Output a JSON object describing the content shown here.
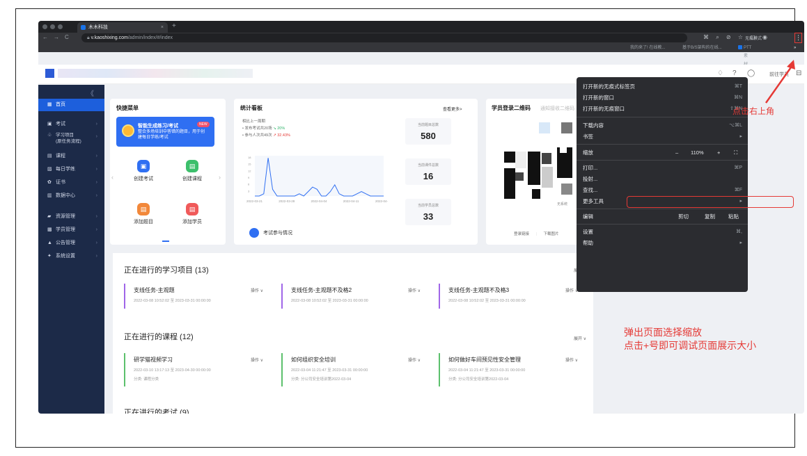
{
  "browser": {
    "tab_title": "木木科技",
    "tab_close": "×",
    "new_tab": "+",
    "nav": [
      "←",
      "→",
      "C"
    ],
    "url_domain": "v.kaoshixing.com",
    "url_path": "/admin/index/#/index",
    "toolbar_icons": "⌘ ⌕ ⊘ ☆ ▢ ◉",
    "incognito_label": "无痕模式",
    "kebab": "⋮",
    "bookmarks": [
      "我的来了! 在线教...",
      "基于B/S架构的在线...",
      "PTT素材网"
    ],
    "bookmark_more": "»"
  },
  "app_header": {
    "icons": [
      "♢",
      "?",
      "◯"
    ],
    "user_link": "前往学员",
    "exit_icon": "⊟"
  },
  "sidebar": {
    "collapse": "《",
    "items": [
      {
        "icon": "▦",
        "label": "首页",
        "active": true
      },
      {
        "icon": "▣",
        "label": "考试"
      },
      {
        "icon": "♧",
        "label": "学习项目\n(原任务流程)"
      },
      {
        "icon": "▤",
        "label": "课程"
      },
      {
        "icon": "▨",
        "label": "每日学练"
      },
      {
        "icon": "✿",
        "label": "证书"
      },
      {
        "icon": "▥",
        "label": "数据中心"
      },
      {
        "icon": "▰",
        "label": "资源管理"
      },
      {
        "icon": "▩",
        "label": "学员管理"
      },
      {
        "icon": "▲",
        "label": "公告管理"
      },
      {
        "icon": "✦",
        "label": "系统设置"
      }
    ],
    "chevron": "›"
  },
  "quick_menu": {
    "title": "快捷菜单",
    "hero_title": "智能生成练习/考试",
    "hero_tag": "NEW",
    "hero_desc": "整合多场培训中答错的题目，用于创建每日学练/考试",
    "actions": [
      {
        "label": "创建考试",
        "color": "#2f6ff2",
        "icon": "▣"
      },
      {
        "label": "创建课程",
        "color": "#3cbf6b",
        "icon": "▤"
      },
      {
        "label": "添加题目",
        "color": "#f2883a",
        "icon": "▤"
      },
      {
        "label": "添加学员",
        "color": "#f05a5a",
        "icon": "▤"
      }
    ],
    "arrows": [
      "‹",
      "›"
    ]
  },
  "stats": {
    "title": "统计看板",
    "more": "查看更多>",
    "compare_label": "相比上一周期",
    "line1": "• 发布考试共20场",
    "line1_delta": "↘ 20%",
    "line2": "• 参与人次共49次",
    "line2_delta": "↗ 32.43%",
    "kpis": [
      {
        "label": "当前题目总数",
        "value": "580"
      },
      {
        "label": "当前课件总数",
        "value": "16"
      },
      {
        "label": "当前学员总数",
        "value": "33"
      }
    ],
    "exam_link": "考试参与情况"
  },
  "chart_data": {
    "type": "line",
    "x": [
      "2022-03-21",
      "2022-03-28",
      "2022-04-04",
      "2022-04-11",
      "2022-04-"
    ],
    "x_ticks": [
      "2022-03-21",
      "2022-03-28",
      "2022-04-04",
      "2022-04-11",
      "2022-04-"
    ],
    "y_ticks": [
      "18",
      "15",
      "12",
      "9",
      "6",
      "3"
    ],
    "ylim": [
      0,
      18
    ],
    "series": [
      {
        "values": [
          0,
          0,
          1,
          17,
          3,
          0,
          0,
          0,
          0,
          0,
          1,
          0,
          2,
          4,
          3,
          0,
          0,
          2,
          5,
          1,
          0,
          0,
          0,
          1,
          2,
          1,
          0,
          0,
          0,
          0
        ]
      }
    ],
    "color": "#2f6ff2"
  },
  "qr": {
    "title": "学员登录二维码",
    "subtitle": "通知接收二维码",
    "watermark": "无系统",
    "link": "登录链接",
    "download": "下载图片"
  },
  "context_menu": {
    "items": [
      {
        "label": "打开新的无痕式标签页",
        "shortcut": "⌘T"
      },
      {
        "label": "打开新的窗口",
        "shortcut": "⌘N"
      },
      {
        "label": "打开新的无痕窗口",
        "shortcut": "⇧⌘N"
      },
      {
        "label": "下载内容",
        "shortcut": "⌥⌘L"
      },
      {
        "label": "书签",
        "shortcut": "▸"
      },
      {
        "label": "缩放",
        "shortcut": ""
      },
      {
        "label": "打印...",
        "shortcut": "⌘P"
      },
      {
        "label": "投射...",
        "shortcut": ""
      },
      {
        "label": "查找...",
        "shortcut": "⌘F"
      },
      {
        "label": "更多工具",
        "shortcut": "▸"
      },
      {
        "label": "编辑",
        "shortcut": ""
      },
      {
        "label": "设置",
        "shortcut": "⌘,"
      },
      {
        "label": "帮助",
        "shortcut": "▸"
      }
    ],
    "zoom_minus": "–",
    "zoom_value": "110%",
    "zoom_plus": "+",
    "zoom_full": "⛶",
    "edit_cut": "剪切",
    "edit_copy": "复制",
    "edit_paste": "粘贴"
  },
  "annotations": {
    "top": "点击右上角",
    "bottom_line1": "弹出页面选择缩放",
    "bottom_line2": "点击+号即可调试页面展示大小"
  },
  "projects": {
    "title": "正在进行的学习项目 (13)",
    "expand": "展开 ∨",
    "op": "操作 ∨",
    "items": [
      {
        "title": "支线任务-主观题",
        "date": "2022-03-08 10:52:02 至 2023-03-31 00:00:00"
      },
      {
        "title": "支线任务-主观题不及格2",
        "date": "2022-03-08 10:52:02 至 2023-03-31 00:00:00"
      },
      {
        "title": "支线任务-主观题不及格3",
        "date": "2022-03-08 10:52:02 至 2023-03-31 00:00:00"
      }
    ]
  },
  "courses": {
    "title": "正在进行的课程 (12)",
    "expand": "展开 ∨",
    "op": "操作 ∨",
    "items": [
      {
        "title": "研学猫视频学习",
        "date": "2022-03-10 13:17:13 至 2023-04-30 00:00:00",
        "cat": "分类: 课程分类"
      },
      {
        "title": "如何组织安全培训",
        "date": "2022-03-04 11:21:47 至 2023-03-31 00:00:00",
        "cat": "分类: 分公司安全培训第2022-03-04"
      },
      {
        "title": "如何做好车间预见性安全管理",
        "date": "2022-03-04 11:21:47 至 2023-03-31 00:00:00",
        "cat": "分类: 分公司安全培训第2022-03-04"
      }
    ]
  },
  "next_section": "正在进行的考试 (9)"
}
